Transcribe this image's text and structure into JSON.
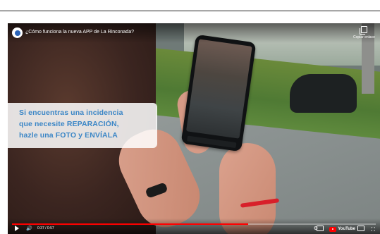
{
  "video": {
    "title": "¿Cómo funciona la nueva APP de La Rinconada?",
    "copy_link_label": "Copiar enlace",
    "caption": {
      "line1": "Si encuentras una incidencia",
      "line2": "que necesite REPARACIÓN,",
      "line3": "hazle una FOTO y ENVÍALA"
    },
    "time": "0:37 / 0:57",
    "progress": 0.65,
    "brand": "YouTube",
    "colors": {
      "caption_text": "#3b86c6",
      "progress": "#ff0000"
    },
    "icons": [
      "play-icon",
      "volume-icon",
      "subtitles-icon",
      "settings-icon",
      "youtube-logo",
      "cast-icon",
      "fullscreen-icon",
      "copy-link-icon",
      "channel-avatar"
    ]
  }
}
